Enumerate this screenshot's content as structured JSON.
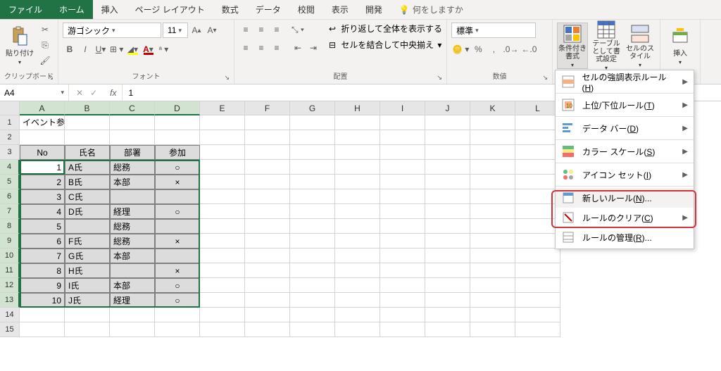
{
  "tabs": {
    "file": "ファイル",
    "home": "ホーム",
    "insert": "挿入",
    "page_layout": "ページ レイアウト",
    "formulas": "数式",
    "data": "データ",
    "review": "校閲",
    "view": "表示",
    "developer": "開発",
    "tell_me": "何をしますか"
  },
  "ribbon": {
    "clipboard": {
      "paste": "貼り付け",
      "label": "クリップボード"
    },
    "font": {
      "name": "游ゴシック",
      "size": "11",
      "label": "フォント"
    },
    "alignment": {
      "wrap": "折り返して全体を表示する",
      "merge": "セルを結合して中央揃え",
      "label": "配置"
    },
    "number": {
      "format": "標準",
      "label": "数値"
    },
    "styles": {
      "cond_fmt": "条件付き書式",
      "table_fmt": "テーブルとして書式設定",
      "cell_styles": "セルのスタイル"
    },
    "cells": {
      "insert": "挿入"
    }
  },
  "formula_bar": {
    "name_box": "A4",
    "formula": "1"
  },
  "columns": [
    "A",
    "B",
    "C",
    "D",
    "E",
    "F",
    "G",
    "H",
    "I",
    "J",
    "K",
    "L"
  ],
  "sheet": {
    "title": "イベント参加者（空白のセルを黄色に設定）",
    "headers": {
      "no": "No",
      "name": "氏名",
      "dept": "部署",
      "attend": "参加"
    },
    "rows": [
      {
        "no": "1",
        "name": "A氏",
        "dept": "総務",
        "attend": "○"
      },
      {
        "no": "2",
        "name": "B氏",
        "dept": "本部",
        "attend": "×"
      },
      {
        "no": "3",
        "name": "C氏",
        "dept": "",
        "attend": ""
      },
      {
        "no": "4",
        "name": "D氏",
        "dept": "経理",
        "attend": "○"
      },
      {
        "no": "5",
        "name": "",
        "dept": "総務",
        "attend": ""
      },
      {
        "no": "6",
        "name": "F氏",
        "dept": "総務",
        "attend": "×"
      },
      {
        "no": "7",
        "name": "G氏",
        "dept": "本部",
        "attend": ""
      },
      {
        "no": "8",
        "name": "H氏",
        "dept": "",
        "attend": "×"
      },
      {
        "no": "9",
        "name": "I氏",
        "dept": "本部",
        "attend": "○"
      },
      {
        "no": "10",
        "name": "J氏",
        "dept": "経理",
        "attend": "○"
      }
    ]
  },
  "menu": {
    "highlight": "セルの強調表示ルール(H)",
    "top_bottom": "上位/下位ルール(T)",
    "data_bars": "データ バー(D)",
    "color_scales": "カラー スケール(S)",
    "icon_sets": "アイコン セット(I)",
    "new_rule": "新しいルール(N)...",
    "clear": "ルールのクリア(C)",
    "manage": "ルールの管理(R)..."
  }
}
